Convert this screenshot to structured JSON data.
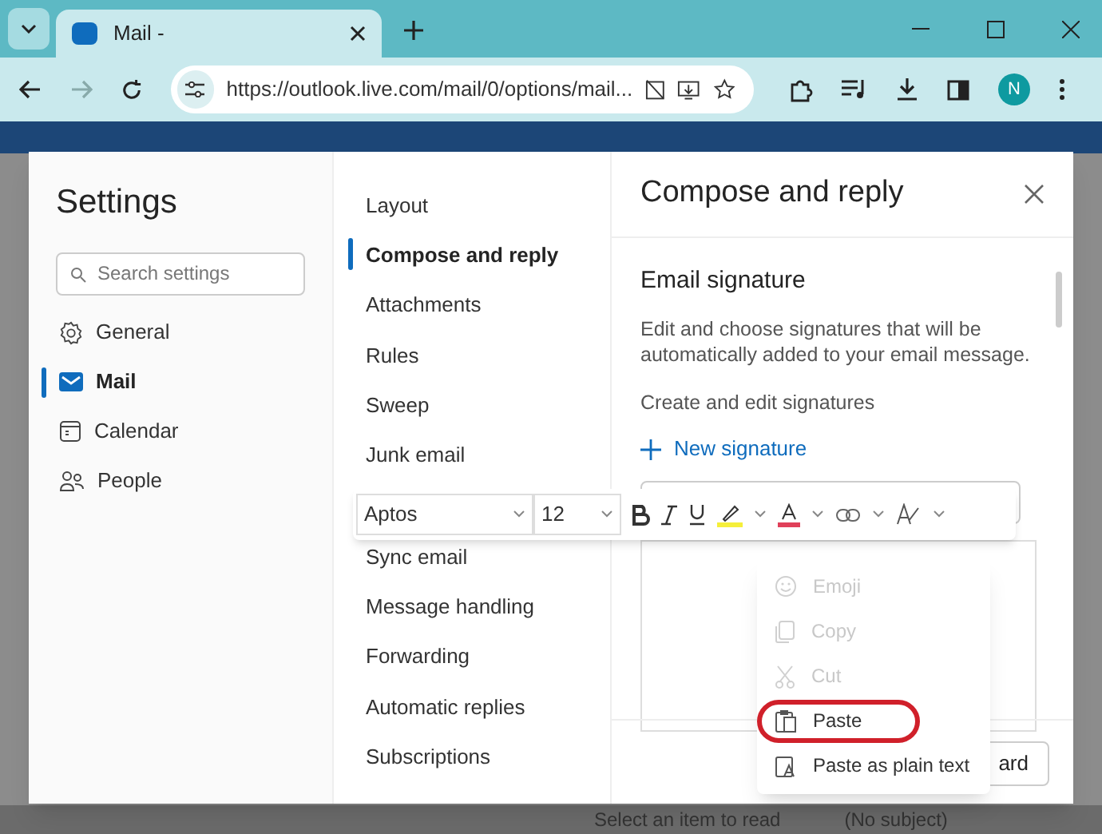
{
  "browser": {
    "tab_title": "Mail -",
    "url": "https://outlook.live.com/mail/0/options/mail...",
    "avatar": "N"
  },
  "background": {
    "reading_pane": "Select an item to read",
    "draft": "(No subject)"
  },
  "settings": {
    "title": "Settings",
    "search": {
      "placeholder": "Search settings"
    },
    "categories": [
      {
        "label": "General",
        "selected": false
      },
      {
        "label": "Mail",
        "selected": true
      },
      {
        "label": "Calendar",
        "selected": false
      },
      {
        "label": "People",
        "selected": false
      }
    ],
    "subnav": [
      {
        "label": "Layout",
        "selected": false
      },
      {
        "label": "Compose and reply",
        "selected": true
      },
      {
        "label": "Attachments",
        "selected": false
      },
      {
        "label": "Rules",
        "selected": false
      },
      {
        "label": "Sweep",
        "selected": false
      },
      {
        "label": "Junk email",
        "selected": false
      },
      {
        "label": "Sync email",
        "selected": false
      },
      {
        "label": "Message handling",
        "selected": false
      },
      {
        "label": "Forwarding",
        "selected": false
      },
      {
        "label": "Automatic replies",
        "selected": false
      },
      {
        "label": "Subscriptions",
        "selected": false
      }
    ]
  },
  "panel": {
    "title": "Compose and reply",
    "section": "Email signature",
    "description": "Edit and choose signatures that will be automatically added to your email message.",
    "create_label": "Create and edit signatures",
    "new_signature": "New signature",
    "footer_button": "ard"
  },
  "format_toolbar": {
    "font": "Aptos",
    "size": "12"
  },
  "context_menu": [
    {
      "label": "Emoji",
      "disabled": true,
      "circled": false
    },
    {
      "label": "Copy",
      "disabled": true,
      "circled": false
    },
    {
      "label": "Cut",
      "disabled": true,
      "circled": false
    },
    {
      "label": "Paste",
      "disabled": false,
      "circled": true
    },
    {
      "label": "Paste as plain text",
      "disabled": false,
      "circled": false
    }
  ]
}
